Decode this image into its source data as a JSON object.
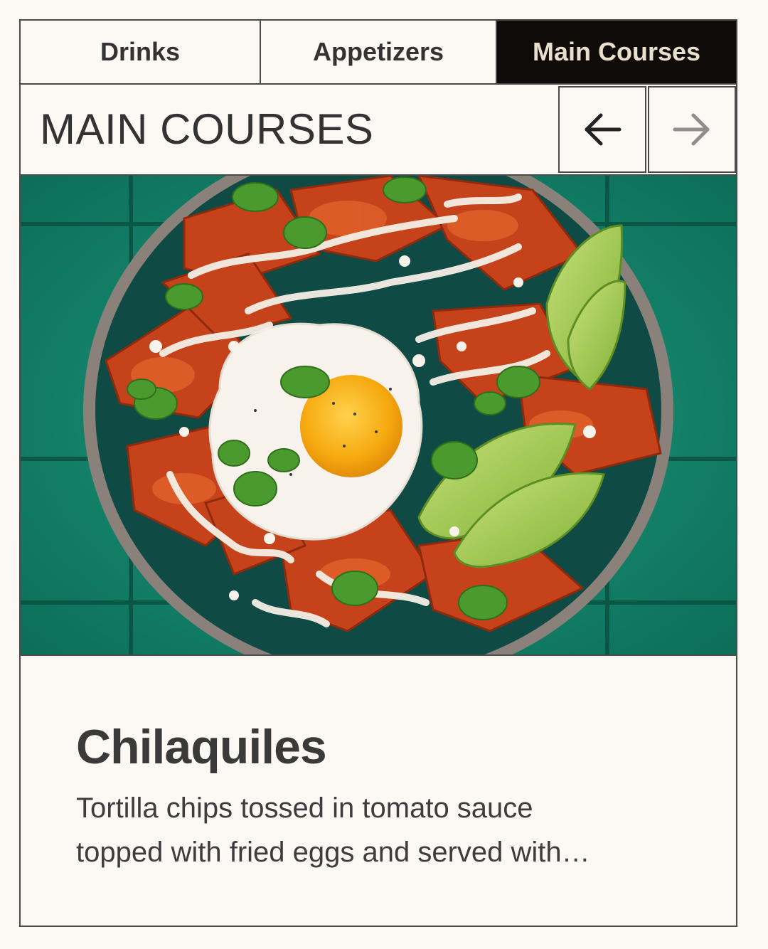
{
  "tabs": [
    {
      "label": "Drinks"
    },
    {
      "label": "Appetizers"
    },
    {
      "label": "Main Courses",
      "active": true
    }
  ],
  "section": {
    "title": "MAIN COURSES",
    "prev_icon": "arrow-left-icon",
    "next_icon": "arrow-right-icon"
  },
  "dish": {
    "name": "Chilaquiles",
    "description_line1": "Tortilla chips tossed in tomato sauce",
    "description_line2": "topped with fried eggs and served with…",
    "image_icon": "food-photo"
  },
  "colors": {
    "background": "#fcf8f4",
    "border": "#4a4a4a",
    "active_tab_bg": "#0e0b09",
    "active_tab_text": "#eadfcd",
    "text": "#333333"
  }
}
